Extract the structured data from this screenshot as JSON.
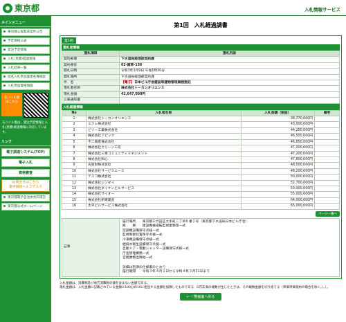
{
  "header": {
    "logo_text": "東京都",
    "service_title": "入札情報サービス"
  },
  "sidebar": {
    "menu_heading": "メインメニュー",
    "menu_items": [
      "東京都公報発表案件公告",
      "予定価格公表",
      "発注予定情報",
      "入札(見積)経過情報",
      "入札結果一覧",
      "指名入札参加業者名簿検索",
      "入札参加資格情報"
    ],
    "mobile_label": "モバイル版",
    "mobile_sub": "はこちら",
    "mobile_note": "モバイル版は、発注予定情報と入札(見積)経過情報に対応しています。",
    "links_heading": "リンク",
    "big_buttons": [
      "電子調達システム(TOP)",
      "電子入札",
      "資格審査"
    ],
    "orange_line1": "お問合せはこちら",
    "orange_line2": "電子調達ヘルプデスク",
    "links": [
      "東京都電子自治体共同運営",
      "東京都公式ホームページ"
    ]
  },
  "page": {
    "title": "第1回　入札経過調書",
    "tab": "第1回"
  },
  "summary": {
    "heading": "落札者情報",
    "col_item": "落札項目",
    "col_content": "落札内容",
    "rows": [
      {
        "label": "契約部署",
        "value": "下水道局経理部契約課"
      },
      {
        "label": "契約番号",
        "value": "02-雑草-136"
      },
      {
        "label": "開札日時",
        "value": "令和3年3月9日 午後1時30分"
      },
      {
        "label": "開札場所",
        "value": "下水道局経理部契約課"
      },
      {
        "label": "件　名",
        "value_prefix": "【電子】",
        "value": "日本ビル庁舎建設等建物管理業務委託"
      },
      {
        "label": "落札者名称",
        "value": "株式会社トーカンオリエンス"
      },
      {
        "label": "落札金額",
        "value": "42,647,000円"
      },
      {
        "label": "公表通知書",
        "value": ""
      }
    ]
  },
  "bids": {
    "heading": "入札経過情報",
    "col_no": "No",
    "col_name": "入札者名称",
    "col_amount": "入札金額（税抜）",
    "col_note": "備考",
    "rows": [
      {
        "no": "1",
        "name": "株式会社トーカンオリエンス",
        "amount": "38,770,000円"
      },
      {
        "no": "2",
        "name": "エクレ株式会社",
        "amount": "43,000,000円"
      },
      {
        "no": "3",
        "name": "ビソー工業株式会社",
        "amount": "44,250,000円"
      },
      {
        "no": "4",
        "name": "株式会社アピック",
        "amount": "46,500,000円"
      },
      {
        "no": "5",
        "name": "不二興産株式会社",
        "amount": "46,850,000円"
      },
      {
        "no": "6",
        "name": "株式会社クリーン工房",
        "amount": "47,000,000円"
      },
      {
        "no": "7",
        "name": "株式会社三幸コミュニティマネジメント",
        "amount": "47,200,000円"
      },
      {
        "no": "8",
        "name": "株式会社和心",
        "amount": "47,800,000円"
      },
      {
        "no": "9",
        "name": "光管財株式会社",
        "amount": "48,000,000円"
      },
      {
        "no": "10",
        "name": "株式会社サービスエース",
        "amount": "48,200,000円"
      },
      {
        "no": "11",
        "name": "テスコ株式会社",
        "amount": "50,000,000円"
      },
      {
        "no": "12",
        "name": "株式会社ジンダイ",
        "amount": "52,700,000円"
      },
      {
        "no": "13",
        "name": "株式会社ダイケンビルサービス",
        "amount": "53,000,000円"
      },
      {
        "no": "14",
        "name": "株式会社サイオー",
        "amount": "55,000,000円"
      },
      {
        "no": "15",
        "name": "株式会社新東美装",
        "amount": "64,000,000円"
      },
      {
        "no": "16",
        "name": "太平ビルサービス株式会社",
        "amount": "65,000,000円"
      }
    ],
    "pager_button": "ページ一番へ"
  },
  "remarks": {
    "label": "記事",
    "text": "履行場所　　東京都千代田区大手町二丁目６番２号（東京都下水道局日本ビル庁舎）\n概　　要　　建設機械運転監視業務等一式\n空調機設備保守点検一式\n監視制御装置保守点検一式\n冷凍機設備保守点検一式\n給排水衛生設備保守点検一式\n自動ドア・電動シャッター設備保守点検一式\n庁舎管理業務一式\n営繕業務出隊他一式\n\n詳細は別添の仕様書のとおり\n履行期間　　令和３年４月１日から令和４年３月31日まで"
  },
  "footnote": "入札金額は、消費税及び地方消費税の額を含まない金額である。\n落札金額は、入札金額に記載されている金額に100分の10に相当する金額を加算したものである（1円未満の端数が生じたときは、その端数金額を切り捨てる（単価単価契約の場合を除く。）。）。",
  "back_button": "← 一覧画面へ戻る"
}
